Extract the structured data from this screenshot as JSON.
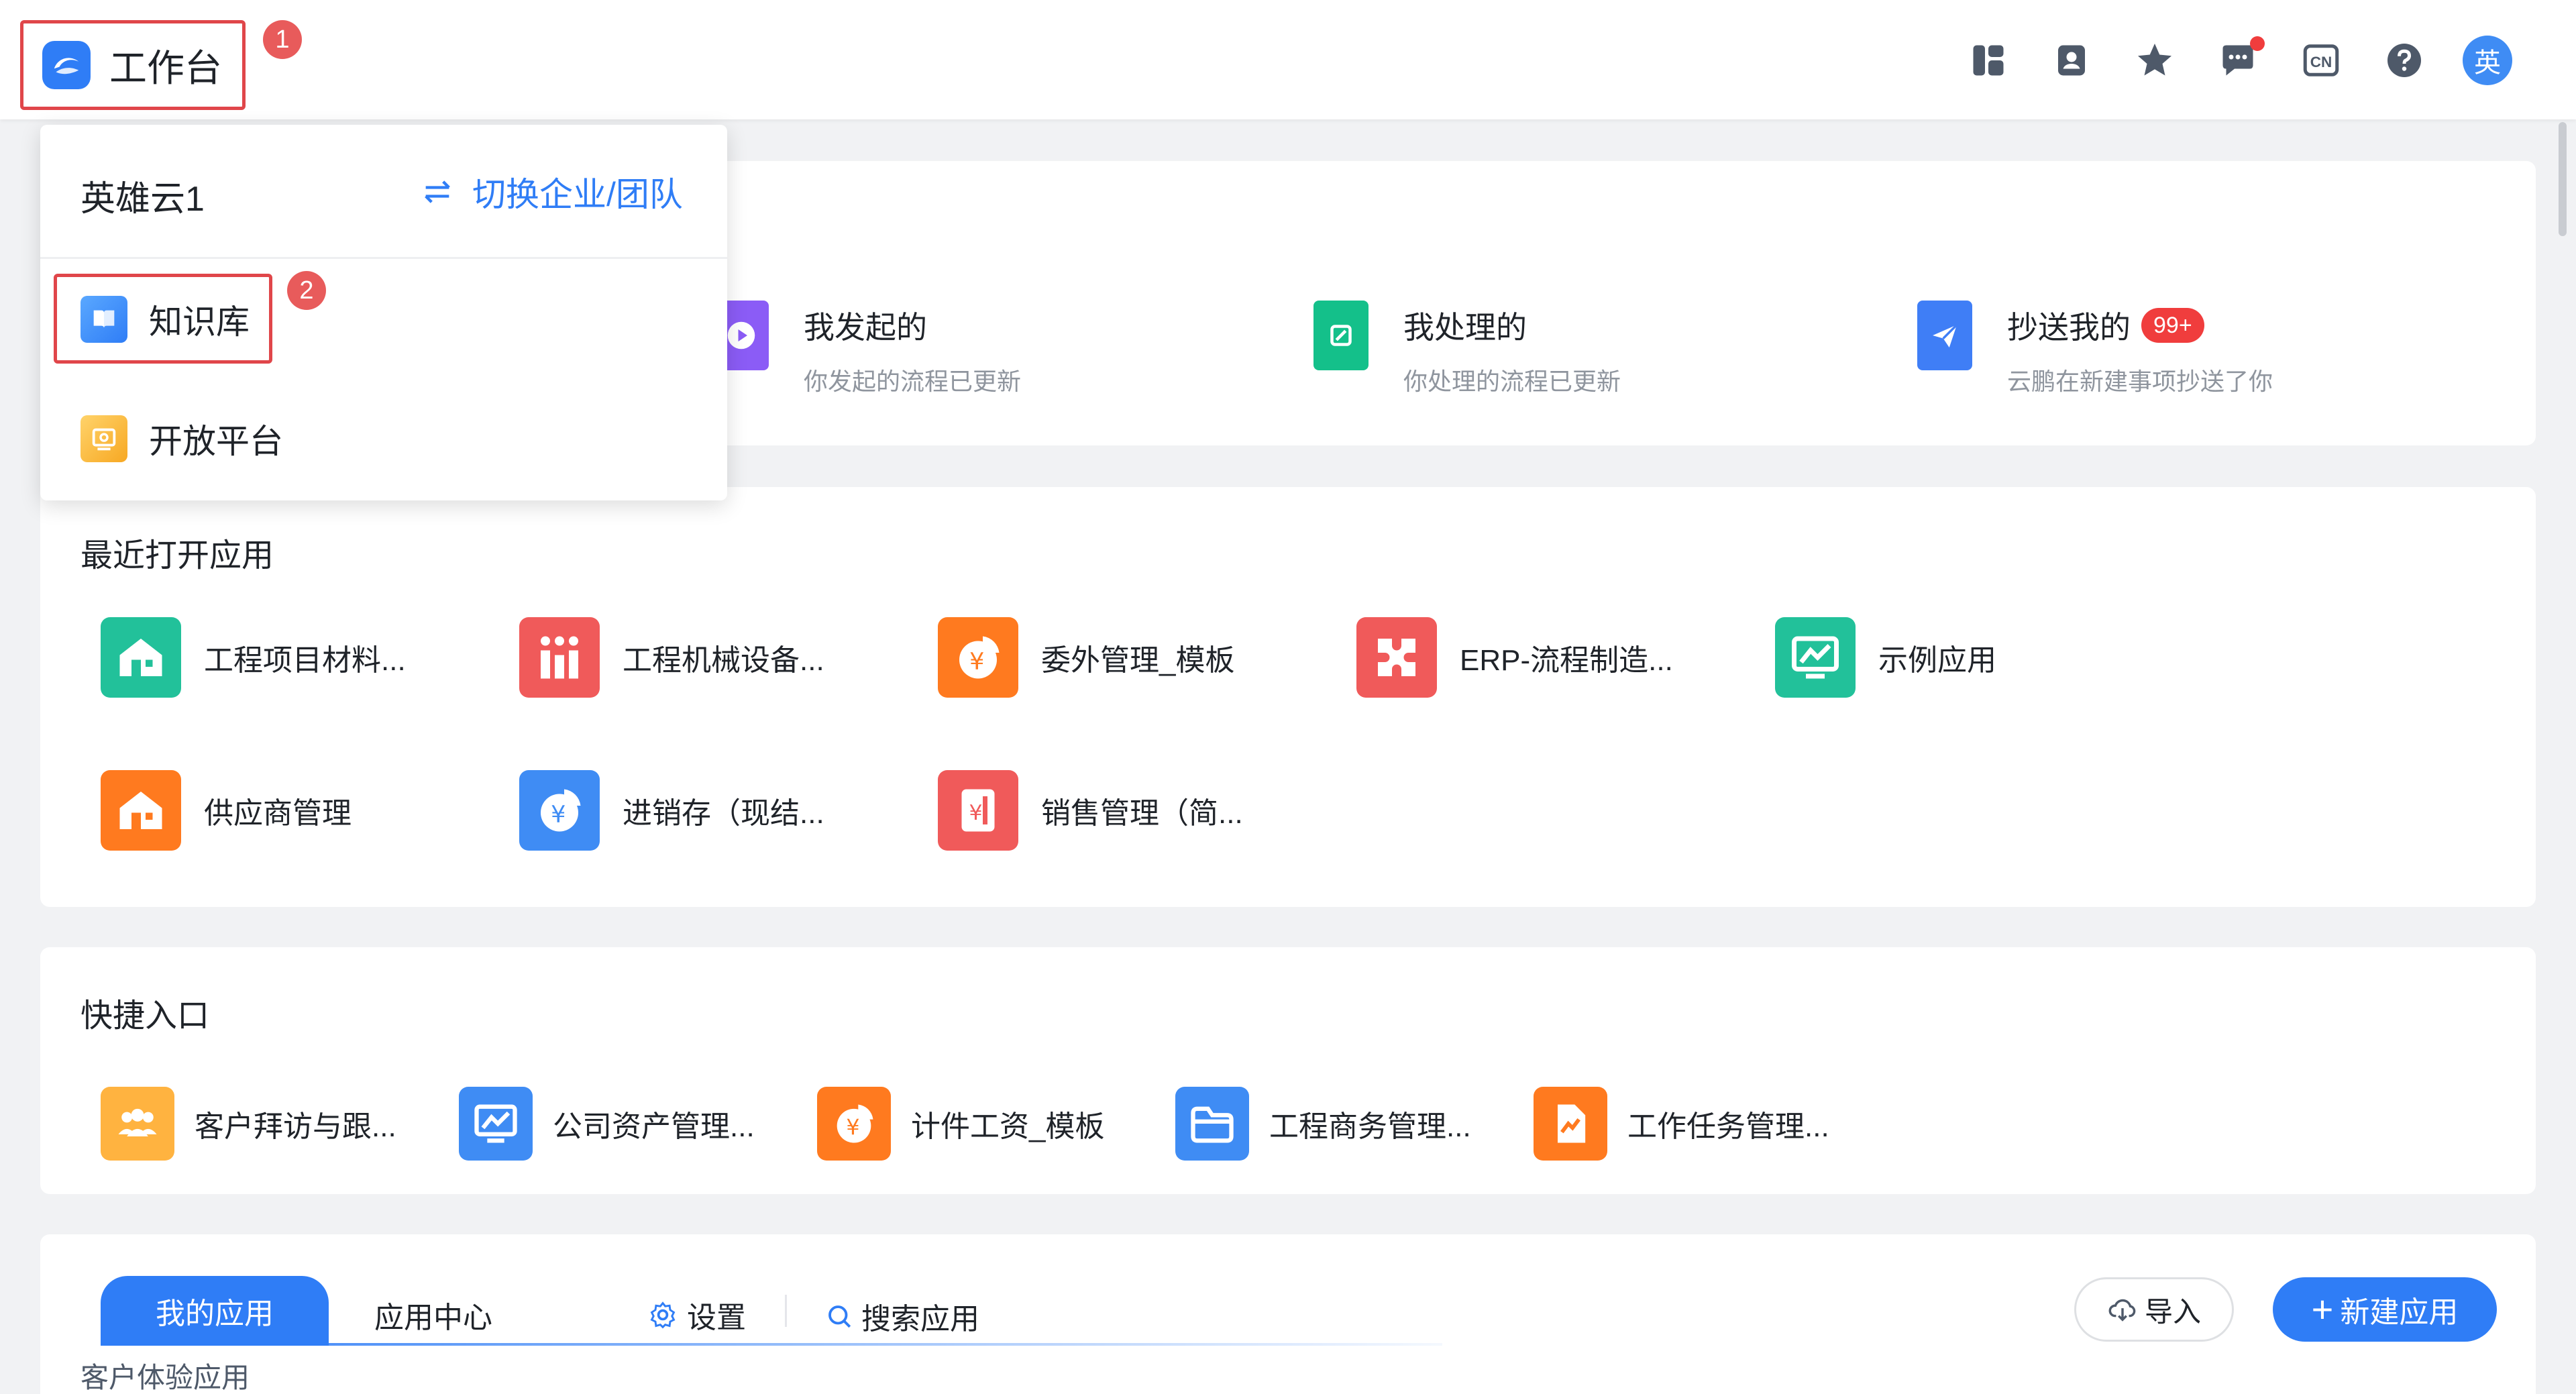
{
  "header": {
    "title": "工作台",
    "step1": "1",
    "avatar_text": "英",
    "icons": [
      "layout-icon",
      "contacts-icon",
      "star-icon",
      "message-icon",
      "language-cn-icon",
      "help-icon"
    ],
    "language_label": "CN"
  },
  "dropdown": {
    "org_name": "英雄云1",
    "switch_label": "切换企业/团队",
    "step2": "2",
    "items": [
      {
        "label": "知识库",
        "icon": "book-icon"
      },
      {
        "label": "开放平台",
        "icon": "open-platform-icon"
      }
    ]
  },
  "flows": [
    {
      "title": "我发起的",
      "sub": "你发起的流程已更新",
      "icon": "play-icon",
      "color": "#8b5cf6"
    },
    {
      "title": "我处理的",
      "sub": "你处理的流程已更新",
      "icon": "document-icon",
      "color": "#14c08a"
    },
    {
      "title": "抄送我的",
      "sub": "云鹏在新建事项抄送了你",
      "icon": "send-icon",
      "color": "#3f7ef6",
      "badge": "99+"
    }
  ],
  "recent": {
    "title": "最近打开应用",
    "apps": [
      {
        "label": "工程项目材料...",
        "color": "#22c19a",
        "icon": "building-icon"
      },
      {
        "label": "工程机械设备...",
        "color": "#f05a5a",
        "icon": "people-icon"
      },
      {
        "label": "委外管理_模板",
        "color": "#ff7a1f",
        "icon": "yuan-pie-icon"
      },
      {
        "label": "ERP-流程制造...",
        "color": "#f05a5a",
        "icon": "puzzle-icon"
      },
      {
        "label": "示例应用",
        "color": "#22c19a",
        "icon": "chart-board-icon"
      },
      {
        "label": "供应商管理",
        "color": "#ff7a1f",
        "icon": "building-icon"
      },
      {
        "label": "进销存（现结...",
        "color": "#3f8cf4",
        "icon": "yuan-pie-icon"
      },
      {
        "label": "销售管理（简...",
        "color": "#f05a5a",
        "icon": "receipt-icon"
      }
    ]
  },
  "quick": {
    "title": "快捷入口",
    "items": [
      {
        "label": "客户拜访与跟...",
        "color": "#ffb340",
        "icon": "group-icon"
      },
      {
        "label": "公司资产管理...",
        "color": "#3f8cf4",
        "icon": "chart-board-icon"
      },
      {
        "label": "计件工资_模板",
        "color": "#ff7a1f",
        "icon": "yuan-pie-icon"
      },
      {
        "label": "工程商务管理...",
        "color": "#3f8cf4",
        "icon": "folder-icon"
      },
      {
        "label": "工作任务管理...",
        "color": "#ff7a1f",
        "icon": "task-doc-icon"
      }
    ]
  },
  "apps_panel": {
    "tab_active": "我的应用",
    "tab_center": "应用中心",
    "settings": "设置",
    "search": "搜索应用",
    "import": "导入",
    "new_app": "新建应用",
    "section": "客户体验应用"
  }
}
